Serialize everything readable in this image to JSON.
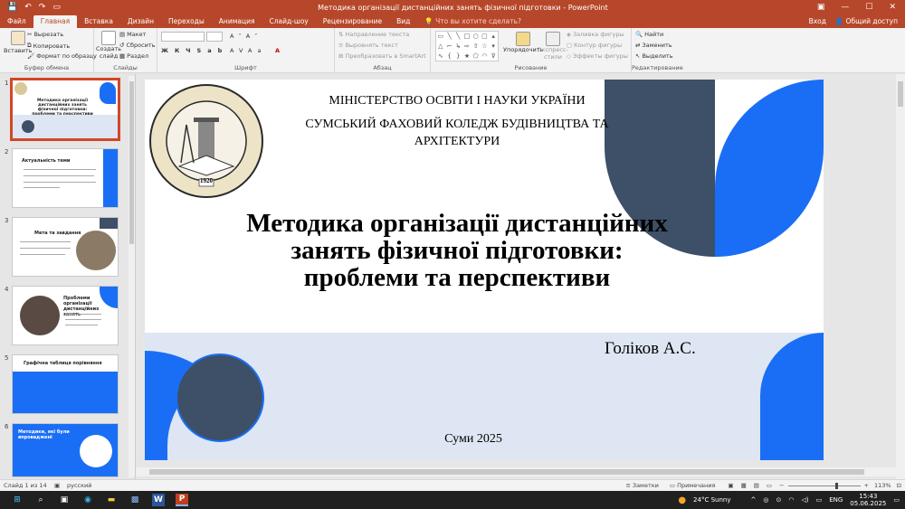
{
  "window": {
    "title": "Методика організації дистанційних занять фізичної підготовки - PowerPoint",
    "sign_in": "Вход",
    "share": "Общий доступ"
  },
  "tabs": [
    "Файл",
    "Главная",
    "Вставка",
    "Дизайн",
    "Переходы",
    "Анимация",
    "Слайд-шоу",
    "Рецензирование",
    "Вид"
  ],
  "tell_me": "Что вы хотите сделать?",
  "ribbon": {
    "clipboard": {
      "paste": "Вставить",
      "cut": "Вырезать",
      "copy": "Копировать",
      "format": "Формат по образцу",
      "label": "Буфер обмена"
    },
    "slides": {
      "new": "Создать",
      "new2": "слайд",
      "layout": "Макет",
      "reset": "Сбросить",
      "section": "Раздел",
      "label": "Слайды"
    },
    "font": {
      "label": "Шрифт"
    },
    "paragraph": {
      "direction": "Направление текста",
      "align": "Выровнять текст",
      "smartart": "Преобразовать в SmartArt",
      "label": "Абзац"
    },
    "drawing": {
      "arrange": "Упорядочить",
      "quick": "Экспресс-",
      "quick2": "стили",
      "fill": "Заливка фигуры",
      "outline": "Контур фигуры",
      "effects": "Эффекты фигуры",
      "label": "Рисование"
    },
    "editing": {
      "find": "Найти",
      "replace": "Заменить",
      "select": "Выделить",
      "label": "Редактирование"
    }
  },
  "thumbnails": [
    {
      "num": "1",
      "title": "Методика організації дистанційних занять фізичної підготовки: проблеми та перспективи"
    },
    {
      "num": "2",
      "title": "Актуальність теми"
    },
    {
      "num": "3",
      "title": "Мета та завдання"
    },
    {
      "num": "4",
      "title": "Проблеми організації дистанційних занять"
    },
    {
      "num": "5",
      "title": "Графічна таблиця порівняння"
    },
    {
      "num": "6",
      "title": "Методики, які були впроваджені"
    }
  ],
  "slide": {
    "ministry": "МІНІСТЕРСТВО ОСВІТИ І НАУКИ УКРАЇНИ",
    "college1": "СУМСЬКИЙ ФАХОВИЙ КОЛЕДЖ БУДІВНИЦТВА ТА",
    "college2": "АРХІТЕКТУРИ",
    "title1": "Методика організації дистанційних",
    "title2": "занять фізичної підготовки:",
    "title3": "проблеми та перспективи",
    "author": "Голіков А.С.",
    "city": "Суми 2025",
    "logo_text": "СУМСЬКИЙ ФАХОВИЙ КОЛЕДЖ БУДІВНИЦТВА ТА АРХІТЕКТУРИ",
    "logo_year": "1920"
  },
  "status": {
    "slide": "Слайд 1 из 14",
    "lang": "русский",
    "notes": "Заметки",
    "comments": "Примечания",
    "zoom": "113%"
  },
  "taskbar": {
    "weather": "24°C  Sunny",
    "lang": "ENG",
    "time": "15:43",
    "date": "05.06.2025"
  },
  "colors": {
    "accent": "#b7472a",
    "slide_blue": "#1a6ef5",
    "slide_dark": "#3e4f68",
    "slide_band": "#dde6f2"
  }
}
